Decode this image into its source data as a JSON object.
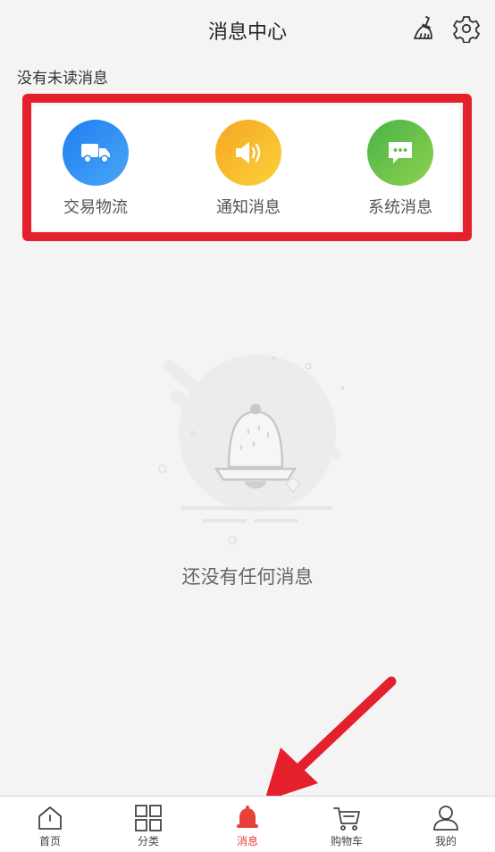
{
  "header": {
    "title": "消息中心",
    "clean_icon": "broom-icon",
    "settings_icon": "gear-icon"
  },
  "status": {
    "unread_text": "没有未读消息"
  },
  "categories": [
    {
      "label": "交易物流",
      "icon": "truck-icon",
      "color": "#1f7ef2"
    },
    {
      "label": "通知消息",
      "icon": "speaker-icon",
      "color": "#f5a623"
    },
    {
      "label": "系统消息",
      "icon": "chat-bubble-icon",
      "color": "#47b34a"
    }
  ],
  "empty_state": {
    "text": "还没有任何消息",
    "icon": "bell-illustration"
  },
  "tabbar": {
    "items": [
      {
        "label": "首页",
        "icon": "home-icon"
      },
      {
        "label": "分类",
        "icon": "grid-icon"
      },
      {
        "label": "消息",
        "icon": "bell-icon",
        "active": true
      },
      {
        "label": "购物车",
        "icon": "cart-icon"
      },
      {
        "label": "我的",
        "icon": "user-icon"
      }
    ],
    "active_color": "#e8413a"
  },
  "annotation": {
    "highlight_color": "#e3202c"
  }
}
